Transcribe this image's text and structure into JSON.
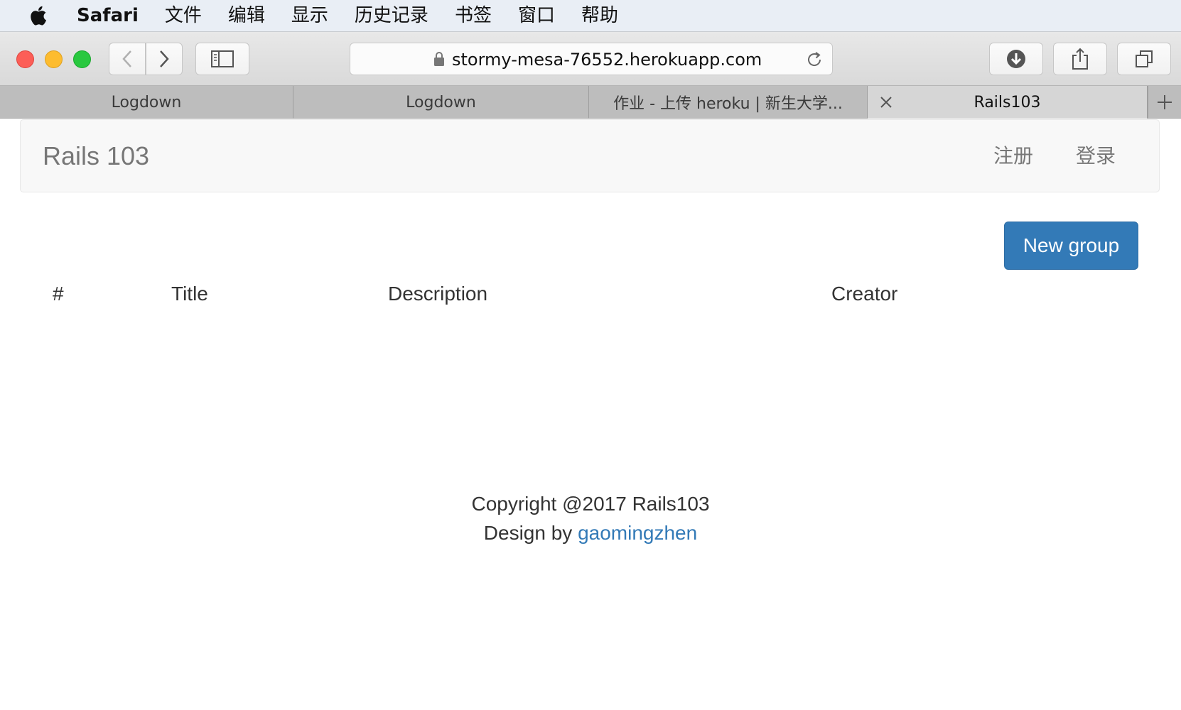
{
  "menubar": {
    "app_name": "Safari",
    "items": [
      "文件",
      "编辑",
      "显示",
      "历史记录",
      "书签",
      "窗口",
      "帮助"
    ]
  },
  "toolbar": {
    "url": "stormy-mesa-76552.herokuapp.com"
  },
  "tabs": [
    {
      "label": "Logdown"
    },
    {
      "label": "Logdown"
    },
    {
      "label": "作业 - 上传 heroku | 新生大学..."
    },
    {
      "label": "Rails103"
    }
  ],
  "page": {
    "brand": "Rails 103",
    "nav": {
      "signup": "注册",
      "login": "登录"
    },
    "new_group_button": "New group",
    "table_headers": [
      "#",
      "Title",
      "Description",
      "Creator"
    ],
    "footer": {
      "copyright": "Copyright @2017 Rails103",
      "design_prefix": "Design by ",
      "author": "gaomingzhen"
    }
  },
  "colors": {
    "primary": "#337ab7",
    "navbar_bg": "#f8f8f8",
    "link": "#337ab7"
  }
}
